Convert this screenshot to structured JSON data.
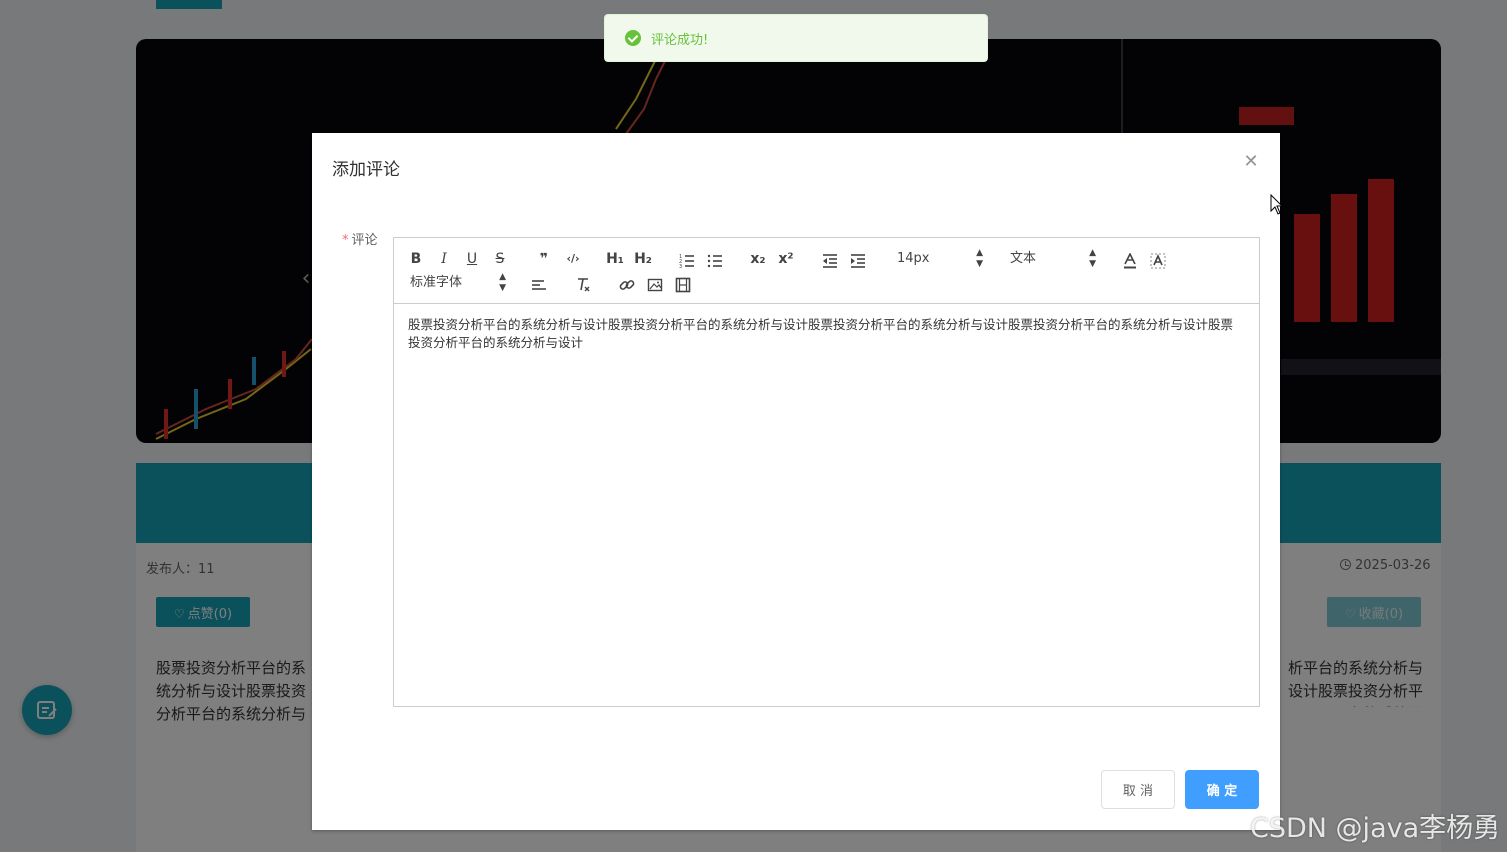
{
  "toast": {
    "message": "评论成功!",
    "color": "#67c23a"
  },
  "background": {
    "publisher": "发布人：11",
    "date": "2025-03-26",
    "like_label": "点赞(0)",
    "favorite_label": "收藏(0)",
    "article_excerpt_left": "股票投资分析平台的系统分析与设计股票投资分析平台的系统分析与设计股票投资分析",
    "article_excerpt_right": "析平台的系统分析与设计股票投资分析平台的系统分",
    "accent": "#17a2b8"
  },
  "dialog": {
    "title": "添加评论",
    "field_label": "评论",
    "cancel_label": "取 消",
    "confirm_label": "确 定",
    "confirm_color": "#409eff"
  },
  "editor": {
    "toolbar": {
      "bold": "B",
      "italic": "I",
      "underline": "U",
      "strike": "S",
      "blockquote": "❞",
      "code": "‹/›",
      "h1": "H₁",
      "h2": "H₂",
      "subscript": "x₂",
      "superscript": "x²",
      "font_size": "14px",
      "header": "文本",
      "font_family": "标准字体"
    },
    "content": "股票投资分析平台的系统分析与设计股票投资分析平台的系统分析与设计股票投资分析平台的系统分析与设计股票投资分析平台的系统分析与设计股票投资分析平台的系统分析与设计"
  },
  "watermark": "CSDN @java李杨勇"
}
